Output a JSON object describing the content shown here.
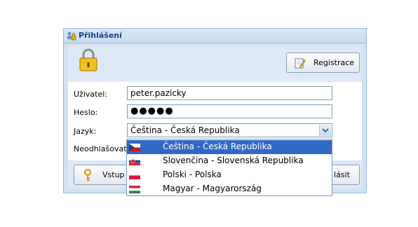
{
  "panel": {
    "title": "Přihlášení"
  },
  "toolbar": {
    "register_label": "Registrace"
  },
  "form": {
    "user_label": "Uživatel:",
    "user_value": "peter.pazicky",
    "password_label": "Heslo:",
    "password_mask": "●●●●●",
    "language_label": "Jazyk:",
    "language_value": "Čeština - Česká Republika",
    "autologout_label": "Neodhlašovat:"
  },
  "buttons": {
    "login_partial": "Vstup b",
    "other_partial": "lásit"
  },
  "language_options": [
    {
      "label": "Čeština - Česká Republika",
      "flag": "cz-flag-icon",
      "selected": true
    },
    {
      "label": "Slovenčina - Slovenská Republika",
      "flag": "sk-flag-icon",
      "selected": false
    },
    {
      "label": "Polski - Polska",
      "flag": "pl-flag-icon",
      "selected": false
    },
    {
      "label": "Magyar - Magyarország",
      "flag": "hu-flag-icon",
      "selected": false
    }
  ],
  "colors": {
    "header_text": "#15428b",
    "panel_border": "#99bbe8",
    "selection": "#316ac5"
  }
}
